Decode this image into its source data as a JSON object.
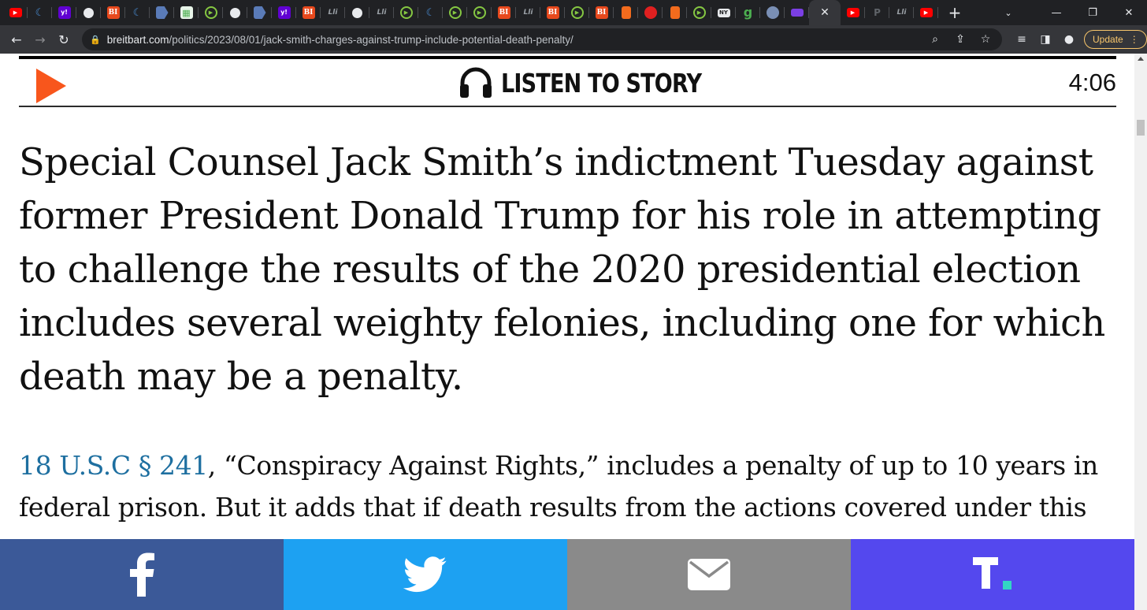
{
  "browser": {
    "tabs": [
      {
        "icon": "youtube-icon",
        "color": "#ff0000",
        "glyph": "▶"
      },
      {
        "icon": "crescent-icon",
        "color": "#4a90d9",
        "glyph": "☾"
      },
      {
        "icon": "yahoo-icon",
        "color": "#6001d2",
        "glyph": "y!"
      },
      {
        "icon": "globe-icon",
        "color": "#9aa0a6",
        "glyph": "◍"
      },
      {
        "icon": "breitbart-icon",
        "color": "#e8491d",
        "glyph": "B"
      },
      {
        "icon": "crescent-icon",
        "color": "#4a90d9",
        "glyph": "☾"
      },
      {
        "icon": "arrow-tag-icon",
        "color": "#5a7bb8",
        "glyph": "▶"
      },
      {
        "icon": "map-icon",
        "color": "#4caf50",
        "glyph": "▦"
      },
      {
        "icon": "rumble-icon",
        "color": "#85c742",
        "glyph": "▶"
      },
      {
        "icon": "globe-icon",
        "color": "#9aa0a6",
        "glyph": "◍"
      },
      {
        "icon": "arrow-tag-icon",
        "color": "#5a7bb8",
        "glyph": "▶"
      },
      {
        "icon": "yahoo-icon",
        "color": "#6001d2",
        "glyph": "y!"
      },
      {
        "icon": "breitbart-icon",
        "color": "#e8491d",
        "glyph": "B"
      },
      {
        "icon": "slash-icon",
        "color": "#9aa0a6",
        "glyph": "//"
      },
      {
        "icon": "globe-icon",
        "color": "#9aa0a6",
        "glyph": "◍"
      },
      {
        "icon": "slash-icon",
        "color": "#9aa0a6",
        "glyph": "//"
      },
      {
        "icon": "rumble-icon",
        "color": "#85c742",
        "glyph": "▶"
      },
      {
        "icon": "crescent-icon",
        "color": "#4a90d9",
        "glyph": "☾"
      },
      {
        "icon": "rumble-icon",
        "color": "#85c742",
        "glyph": "▶"
      },
      {
        "icon": "rumble-icon",
        "color": "#85c742",
        "glyph": "▶"
      },
      {
        "icon": "breitbart-icon",
        "color": "#e8491d",
        "glyph": "B"
      },
      {
        "icon": "slash-icon",
        "color": "#9aa0a6",
        "glyph": "//"
      },
      {
        "icon": "breitbart-icon",
        "color": "#e8491d",
        "glyph": "B"
      },
      {
        "icon": "rumble-icon",
        "color": "#85c742",
        "glyph": "▶"
      },
      {
        "icon": "breitbart-icon",
        "color": "#e8491d",
        "glyph": "B"
      },
      {
        "icon": "bookmark-icon",
        "color": "#f26b1d",
        "glyph": "▬"
      },
      {
        "icon": "pin-icon",
        "color": "#e02020",
        "glyph": "●"
      },
      {
        "icon": "bookmark-icon",
        "color": "#f26b1d",
        "glyph": "▬"
      },
      {
        "icon": "rumble-icon",
        "color": "#85c742",
        "glyph": "▶"
      },
      {
        "icon": "news-icon",
        "color": "#e8eaed",
        "glyph": "NY"
      },
      {
        "icon": "gettr-icon",
        "color": "#4caf50",
        "glyph": "g"
      },
      {
        "icon": "avatar-icon",
        "color": "#7a8fb5",
        "glyph": "●"
      },
      {
        "icon": "purple-icon",
        "color": "#7b3fe4",
        "glyph": "▬"
      },
      {
        "icon": "close-icon",
        "color": "#e8eaed",
        "glyph": "✕",
        "active": true
      },
      {
        "icon": "youtube-icon",
        "color": "#ff0000",
        "glyph": "▶"
      },
      {
        "icon": "parler-icon",
        "color": "#5f6368",
        "glyph": "P"
      },
      {
        "icon": "slash-icon",
        "color": "#9aa0a6",
        "glyph": "//"
      },
      {
        "icon": "youtube-icon",
        "color": "#ff0000",
        "glyph": "▶"
      }
    ],
    "url_host": "breitbart.com",
    "url_path": "/politics/2023/08/01/jack-smith-charges-against-trump-include-potential-death-penalty/",
    "update_label": "Update"
  },
  "player": {
    "label": "LISTEN TO STORY",
    "duration": "4:06",
    "play_color": "#f8561c"
  },
  "article": {
    "lead": "Special Counsel Jack Smith’s indictment Tuesday against former President Donald Trump for his role in attempting to challenge the results of the 2020 presidential election includes several weighty felonies, including one for which death may be a penalty.",
    "link_text": "18 U.S.C § 241",
    "para_rest": ", “Conspiracy Against Rights,” includes a penalty of up to 10 years in federal prison. But it adds that if death results from the actions covered under this"
  },
  "share": [
    {
      "name": "facebook",
      "color": "#3b5998",
      "icon": "facebook-icon"
    },
    {
      "name": "twitter",
      "color": "#1da1f2",
      "icon": "twitter-icon"
    },
    {
      "name": "email",
      "color": "#8a8a8a",
      "icon": "email-icon"
    },
    {
      "name": "truth-social",
      "color": "#5448ee",
      "icon": "truth-social-icon"
    }
  ]
}
